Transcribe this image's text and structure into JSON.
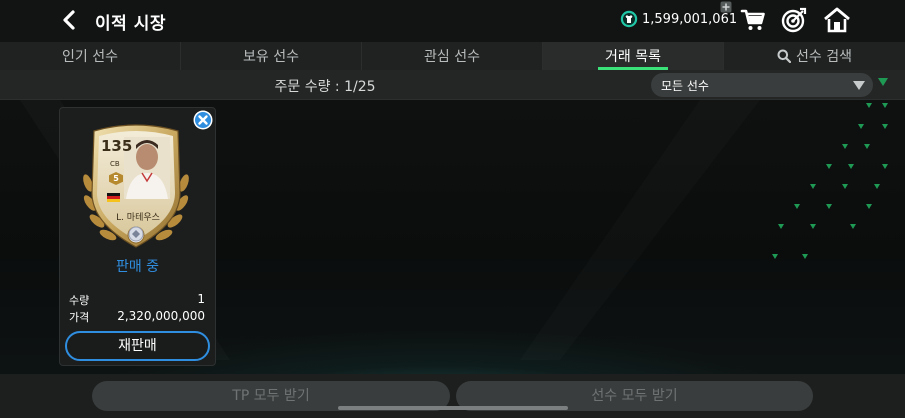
{
  "header": {
    "title": "이적 시장",
    "currency_value": "1,599,001,061",
    "icons": [
      "back-icon",
      "tp-coin-icon",
      "plus-icon",
      "cart-icon",
      "target-icon",
      "home-icon"
    ]
  },
  "tabs": [
    {
      "label": "인기 선수",
      "active": false
    },
    {
      "label": "보유 선수",
      "active": false
    },
    {
      "label": "관심 선수",
      "active": false
    },
    {
      "label": "거래 목록",
      "active": true
    },
    {
      "label": "선수 검색",
      "active": false
    }
  ],
  "filter": {
    "order_count": "주문 수량 : 1/25",
    "dropdown_value": "모든 선수"
  },
  "listing": {
    "ovr": "135",
    "position": "CB",
    "grade": "5",
    "player_name": "L. 마테우스",
    "status": "판매 중",
    "quantity_label": "수량",
    "quantity_value": "1",
    "price_label": "가격",
    "price_value": "2,320,000,000",
    "resell_label": "재판매"
  },
  "bottom": {
    "claim_tp_label": "TP 모두 받기",
    "claim_players_label": "선수 모두 받기"
  },
  "colors": {
    "accent_green": "#3be27a",
    "accent_blue": "#2f8ee0",
    "card_gold": "#c9a85f"
  }
}
